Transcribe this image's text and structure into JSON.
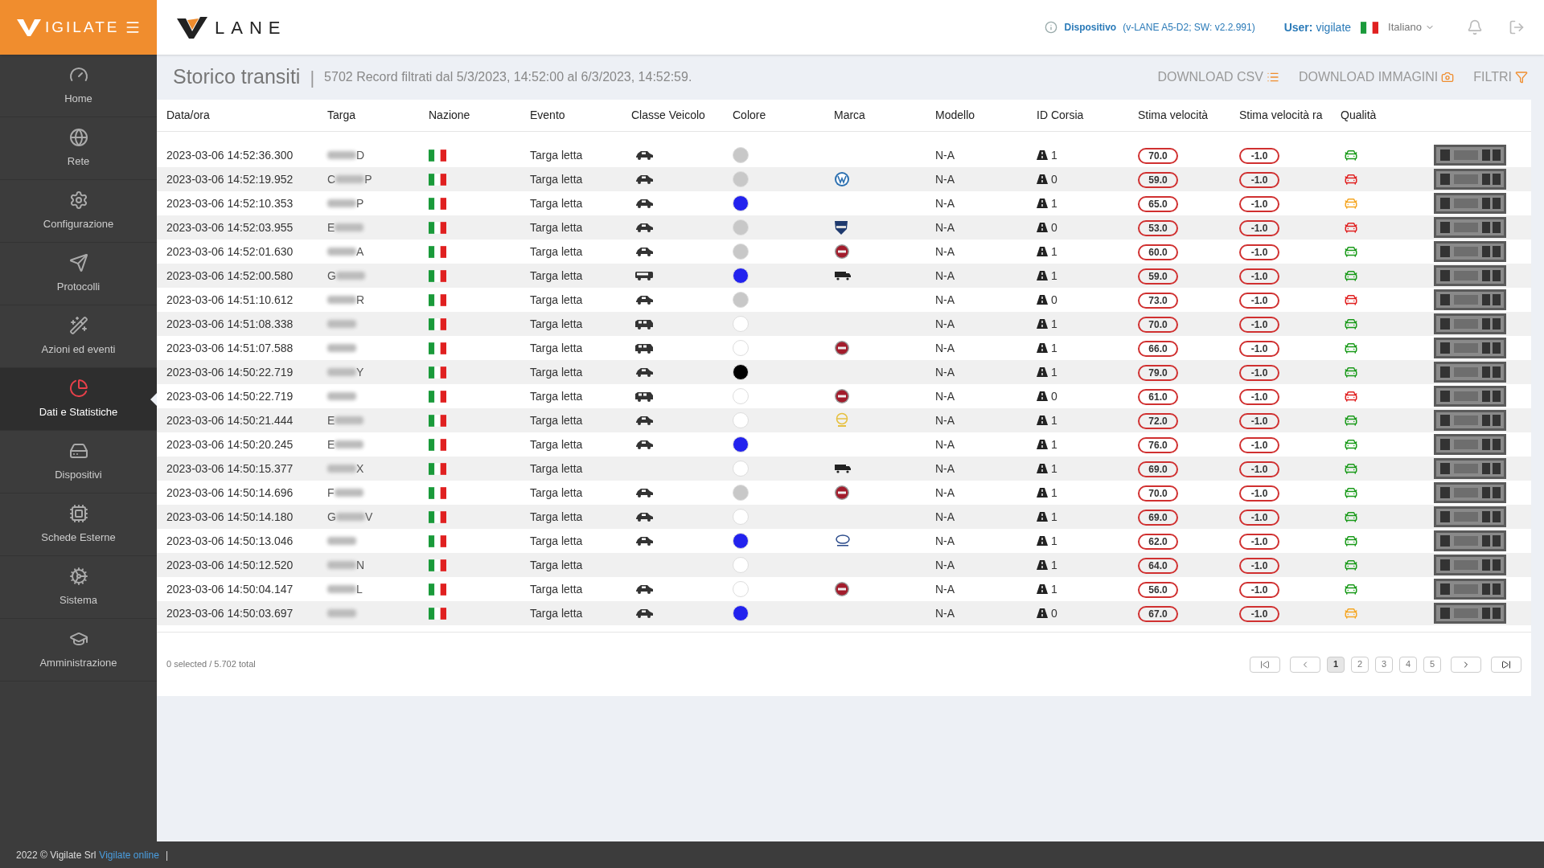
{
  "brand": {
    "logo_text": "IGILATE",
    "product_text": "LANE"
  },
  "topbar": {
    "device_label": "Dispositivo",
    "device_info": "(v-LANE A5-D2; SW: v2.2.991)",
    "user_label": "User:",
    "user_name": "vigilate",
    "language": "Italiano"
  },
  "sidebar": {
    "items": [
      {
        "label": "Home",
        "selected": false
      },
      {
        "label": "Rete",
        "selected": false
      },
      {
        "label": "Configurazione",
        "selected": false
      },
      {
        "label": "Protocolli",
        "selected": false
      },
      {
        "label": "Azioni ed eventi",
        "selected": false
      },
      {
        "label": "Dati e Statistiche",
        "selected": true
      },
      {
        "label": "Dispositivi",
        "selected": false
      },
      {
        "label": "Schede Esterne",
        "selected": false
      },
      {
        "label": "Sistema",
        "selected": false
      },
      {
        "label": "Amministrazione",
        "selected": false
      }
    ]
  },
  "page": {
    "title": "Storico transiti",
    "separator": "|",
    "subtitle": "5702 Record filtrati dal 5/3/2023, 14:52:00 al 6/3/2023, 14:52:59.",
    "actions": [
      {
        "label": "DOWNLOAD CSV"
      },
      {
        "label": "DOWNLOAD IMMAGINI"
      },
      {
        "label": "FILTRI"
      }
    ]
  },
  "table": {
    "columns": [
      "Data/ora",
      "Targa",
      "Nazione",
      "Evento",
      "Classe Veicolo",
      "Colore",
      "Marca",
      "Modello",
      "ID Corsia",
      "Stima velocità",
      "Stima velocità ra",
      "Qualità"
    ],
    "rows": [
      {
        "time": "2023-03-06 14:52:36.300",
        "plate_end": "D",
        "event": "Targa letta",
        "vehicle": {
          "kind": "car"
        },
        "color": "#c8c8c8",
        "model": "N-A",
        "lane": "1",
        "speed": "70.0",
        "speed2": "-1.0",
        "quality": {
          "color": "#1a9a1a"
        }
      },
      {
        "time": "2023-03-06 14:52:19.952",
        "plate_start": "C",
        "plate_end": "P",
        "event": "Targa letta",
        "vehicle": {
          "kind": "car"
        },
        "color": "#c8c8c8",
        "make": {
          "kind": "vw"
        },
        "model": "N-A",
        "lane": "0",
        "speed": "59.0",
        "speed2": "-1.0",
        "quality": {
          "color": "#e02020"
        }
      },
      {
        "time": "2023-03-06 14:52:10.353",
        "plate_end": "P",
        "event": "Targa letta",
        "vehicle": {
          "kind": "car"
        },
        "color": "#2222ee",
        "model": "N-A",
        "lane": "1",
        "speed": "65.0",
        "speed2": "-1.0",
        "quality": {
          "color": "#f5a623"
        }
      },
      {
        "time": "2023-03-06 14:52:03.955",
        "plate_start": "E",
        "event": "Targa letta",
        "vehicle": {
          "kind": "car"
        },
        "color": "#c8c8c8",
        "make": {
          "kind": "lancia"
        },
        "model": "N-A",
        "lane": "0",
        "speed": "53.0",
        "speed2": "-1.0",
        "quality": {
          "color": "#e02020"
        }
      },
      {
        "time": "2023-03-06 14:52:01.630",
        "plate_end": "A",
        "event": "Targa letta",
        "vehicle": {
          "kind": "car"
        },
        "color": "#c8c8c8",
        "make": {
          "kind": "fiat"
        },
        "model": "N-A",
        "lane": "1",
        "speed": "60.0",
        "speed2": "-1.0",
        "quality": {
          "color": "#1a9a1a"
        }
      },
      {
        "time": "2023-03-06 14:52:00.580",
        "plate_start": "G",
        "event": "Targa letta",
        "vehicle": {
          "kind": "bus"
        },
        "color": "#2222ee",
        "make": {
          "kind": "truck"
        },
        "model": "N-A",
        "lane": "1",
        "speed": "59.0",
        "speed2": "-1.0",
        "quality": {
          "color": "#1a9a1a"
        }
      },
      {
        "time": "2023-03-06 14:51:10.612",
        "plate_end": "R",
        "event": "Targa letta",
        "vehicle": {
          "kind": "car"
        },
        "color": "#c8c8c8",
        "model": "N-A",
        "lane": "0",
        "speed": "73.0",
        "speed2": "-1.0",
        "quality": {
          "color": "#e02020"
        }
      },
      {
        "time": "2023-03-06 14:51:08.338",
        "event": "Targa letta",
        "vehicle": {
          "kind": "van"
        },
        "color": "#ffffff",
        "model": "N-A",
        "lane": "1",
        "speed": "70.0",
        "speed2": "-1.0",
        "quality": {
          "color": "#1a9a1a"
        }
      },
      {
        "time": "2023-03-06 14:51:07.588",
        "event": "Targa letta",
        "vehicle": {
          "kind": "van"
        },
        "color": "#ffffff",
        "make": {
          "kind": "fiat"
        },
        "model": "N-A",
        "lane": "1",
        "speed": "66.0",
        "speed2": "-1.0",
        "quality": {
          "color": "#1a9a1a"
        }
      },
      {
        "time": "2023-03-06 14:50:22.719",
        "plate_end": "Y",
        "event": "Targa letta",
        "vehicle": {
          "kind": "car"
        },
        "color": "#000000",
        "model": "N-A",
        "lane": "1",
        "speed": "79.0",
        "speed2": "-1.0",
        "quality": {
          "color": "#1a9a1a"
        }
      },
      {
        "time": "2023-03-06 14:50:22.719",
        "event": "Targa letta",
        "vehicle": {
          "kind": "van"
        },
        "color": "#ffffff",
        "make": {
          "kind": "fiat"
        },
        "model": "N-A",
        "lane": "0",
        "speed": "61.0",
        "speed2": "-1.0",
        "quality": {
          "color": "#e02020"
        }
      },
      {
        "time": "2023-03-06 14:50:21.444",
        "plate_start": "E",
        "event": "Targa letta",
        "vehicle": {
          "kind": "car"
        },
        "color": "#ffffff",
        "make": {
          "kind": "opel"
        },
        "model": "N-A",
        "lane": "1",
        "speed": "72.0",
        "speed2": "-1.0",
        "quality": {
          "color": "#1a9a1a"
        }
      },
      {
        "time": "2023-03-06 14:50:20.245",
        "plate_start": "E",
        "event": "Targa letta",
        "vehicle": {
          "kind": "car"
        },
        "color": "#2222ee",
        "model": "N-A",
        "lane": "1",
        "speed": "76.0",
        "speed2": "-1.0",
        "quality": {
          "color": "#1a9a1a"
        }
      },
      {
        "time": "2023-03-06 14:50:15.377",
        "plate_end": "X",
        "event": "Targa letta",
        "color": "#ffffff",
        "make": {
          "kind": "truck"
        },
        "model": "N-A",
        "lane": "1",
        "speed": "69.0",
        "speed2": "-1.0",
        "quality": {
          "color": "#1a9a1a"
        }
      },
      {
        "time": "2023-03-06 14:50:14.696",
        "plate_start": "F",
        "event": "Targa letta",
        "vehicle": {
          "kind": "car"
        },
        "color": "#c8c8c8",
        "make": {
          "kind": "fiat"
        },
        "model": "N-A",
        "lane": "1",
        "speed": "70.0",
        "speed2": "-1.0",
        "quality": {
          "color": "#1a9a1a"
        }
      },
      {
        "time": "2023-03-06 14:50:14.180",
        "plate_start": "G",
        "plate_end": "V",
        "event": "Targa letta",
        "vehicle": {
          "kind": "car"
        },
        "color": "#ffffff",
        "model": "N-A",
        "lane": "1",
        "speed": "69.0",
        "speed2": "-1.0",
        "quality": {
          "color": "#1a9a1a"
        }
      },
      {
        "time": "2023-03-06 14:50:13.046",
        "event": "Targa letta",
        "vehicle": {
          "kind": "car"
        },
        "color": "#2222ee",
        "make": {
          "kind": "hyundai"
        },
        "model": "N-A",
        "lane": "1",
        "speed": "62.0",
        "speed2": "-1.0",
        "quality": {
          "color": "#1a9a1a"
        }
      },
      {
        "time": "2023-03-06 14:50:12.520",
        "plate_end": "N",
        "event": "Targa letta",
        "color": "#ffffff",
        "model": "N-A",
        "lane": "1",
        "speed": "64.0",
        "speed2": "-1.0",
        "quality": {
          "color": "#1a9a1a"
        }
      },
      {
        "time": "2023-03-06 14:50:04.147",
        "plate_end": "L",
        "event": "Targa letta",
        "vehicle": {
          "kind": "car"
        },
        "color": "#ffffff",
        "make": {
          "kind": "fiat"
        },
        "model": "N-A",
        "lane": "1",
        "speed": "56.0",
        "speed2": "-1.0",
        "quality": {
          "color": "#1a9a1a"
        }
      },
      {
        "time": "2023-03-06 14:50:03.697",
        "event": "Targa letta",
        "vehicle": {
          "kind": "car"
        },
        "color": "#2222ee",
        "model": "N-A",
        "lane": "0",
        "speed": "67.0",
        "speed2": "-1.0",
        "quality": {
          "color": "#f5a623"
        }
      }
    ]
  },
  "footer_table": {
    "selection": "0 selected / 5.702 total",
    "pages": [
      {
        "label": "1",
        "selected": true
      },
      {
        "label": "2",
        "selected": false
      },
      {
        "label": "3",
        "selected": false
      },
      {
        "label": "4",
        "selected": false
      },
      {
        "label": "5",
        "selected": false
      }
    ]
  },
  "footer": {
    "copyright": "2022 © Vigilate Srl",
    "link": "Vigilate online",
    "separator": "|"
  }
}
